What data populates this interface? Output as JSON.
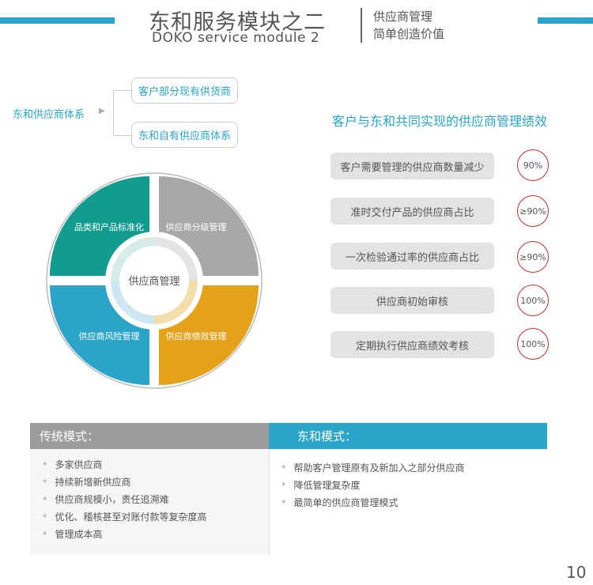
{
  "header": {
    "title_zh": "东和服务模块之二",
    "title_en": "DOKO service module 2",
    "subtitle_line1": "供应商管理",
    "subtitle_line2": "简单创造价值"
  },
  "system": {
    "label": "东和供应商体系",
    "arrow": "▶",
    "options": [
      "客户部分现有供货商",
      "东和自有供应商体系"
    ]
  },
  "wheel": {
    "center": "供应商管理",
    "segments": [
      {
        "label": "品类和产品标准化",
        "color": "#129c8f"
      },
      {
        "label": "供应商分级管理",
        "color": "#a8a8a8"
      },
      {
        "label": "供应商风险管理",
        "color": "#2aa4c9"
      },
      {
        "label": "供应商绩效管理",
        "color": "#e3a21a"
      }
    ]
  },
  "performance": {
    "title": "客户与东和共同实现的供应商管理绩效",
    "items": [
      {
        "label": "客户需要管理的供应商数量减少",
        "badge": "90%"
      },
      {
        "label": "准时交付产品的供应商占比",
        "badge": "≥90%"
      },
      {
        "label": "一次检验通过率的供应商占比",
        "badge": "≥90%"
      },
      {
        "label": "供应商初始审核",
        "badge": "100%"
      },
      {
        "label": "定期执行供应商绩效考核",
        "badge": "100%"
      }
    ]
  },
  "traditional": {
    "title": "传统模式：",
    "items": [
      "多家供应商",
      "持续新增新供应商",
      "供应商规模小，责任追溯难",
      "优化、稽核甚至对账付款等复杂度高",
      "管理成本高"
    ]
  },
  "doko": {
    "title": "东和模式：",
    "items": [
      "帮助客户管理原有及新加入之部分供应商",
      "降低管理复杂度",
      "最简单的供应商管理模式"
    ]
  },
  "bullet_symbol": "*",
  "page_number": "10"
}
